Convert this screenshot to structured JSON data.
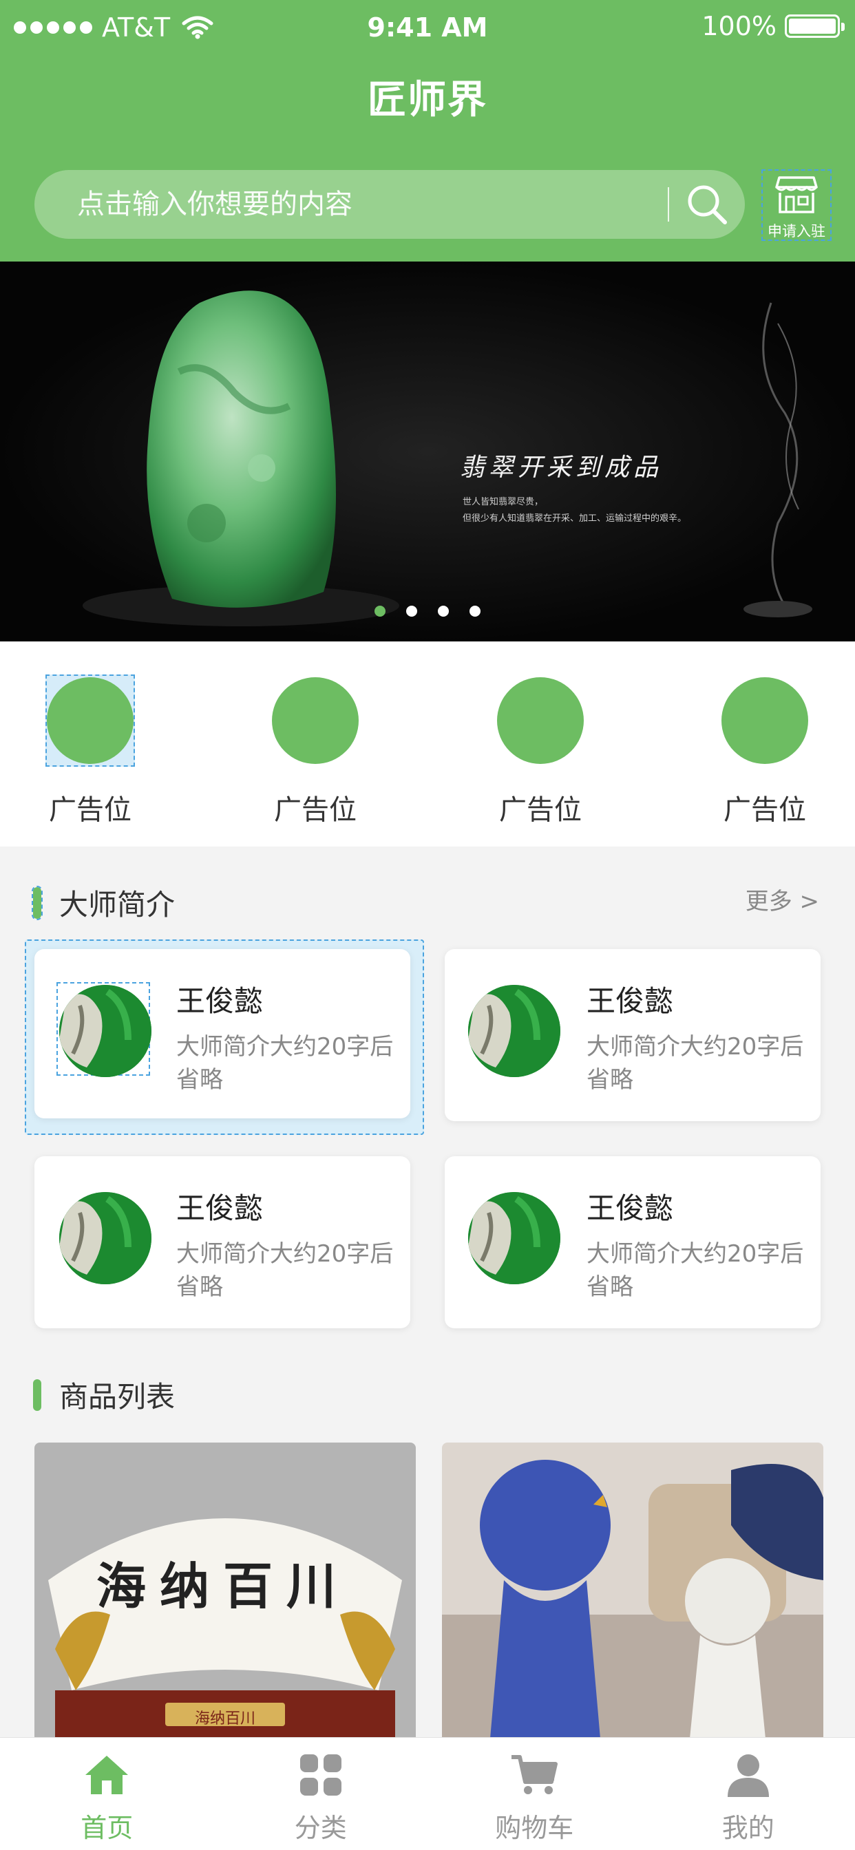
{
  "status_bar": {
    "carrier": "AT&T",
    "time": "9:41 AM",
    "battery": "100%"
  },
  "header": {
    "title": "匠师界",
    "search_placeholder": "点击输入你想要的内容",
    "apply_label": "申请入驻"
  },
  "banner": {
    "heading": "翡翠开采到成品",
    "sub_line_1": "世人皆知翡翠尽贵，",
    "sub_line_2": "但很少有人知道翡翠在开采、加工、运输过程中的艰辛。",
    "dot_count": 4,
    "active_dot": 1
  },
  "ads": [
    {
      "label": "广告位"
    },
    {
      "label": "广告位"
    },
    {
      "label": "广告位"
    },
    {
      "label": "广告位"
    }
  ],
  "masters_section": {
    "title": "大师简介",
    "more": "更多 >"
  },
  "masters": [
    {
      "name": "王俊懿",
      "bio": "大师简介大约20字后省略"
    },
    {
      "name": "王俊懿",
      "bio": "大师简介大约20字后省略"
    },
    {
      "name": "王俊懿",
      "bio": "大师简介大约20字后省略"
    },
    {
      "name": "王俊懿",
      "bio": "大师简介大约20字后省略"
    }
  ],
  "products_section": {
    "title": "商品列表"
  },
  "products": [
    {
      "image_text": "海纳百川",
      "plaque": "海纳百川"
    },
    {
      "image_text": ""
    }
  ],
  "tabs": [
    {
      "label": "首页",
      "icon": "home-icon",
      "active": true
    },
    {
      "label": "分类",
      "icon": "category-icon",
      "active": false
    },
    {
      "label": "购物车",
      "icon": "cart-icon",
      "active": false
    },
    {
      "label": "我的",
      "icon": "user-icon",
      "active": false
    }
  ],
  "colors": {
    "brand_green": "#6dbd62",
    "search_bg": "#98d18f",
    "selection_blue": "#4aa3df"
  }
}
